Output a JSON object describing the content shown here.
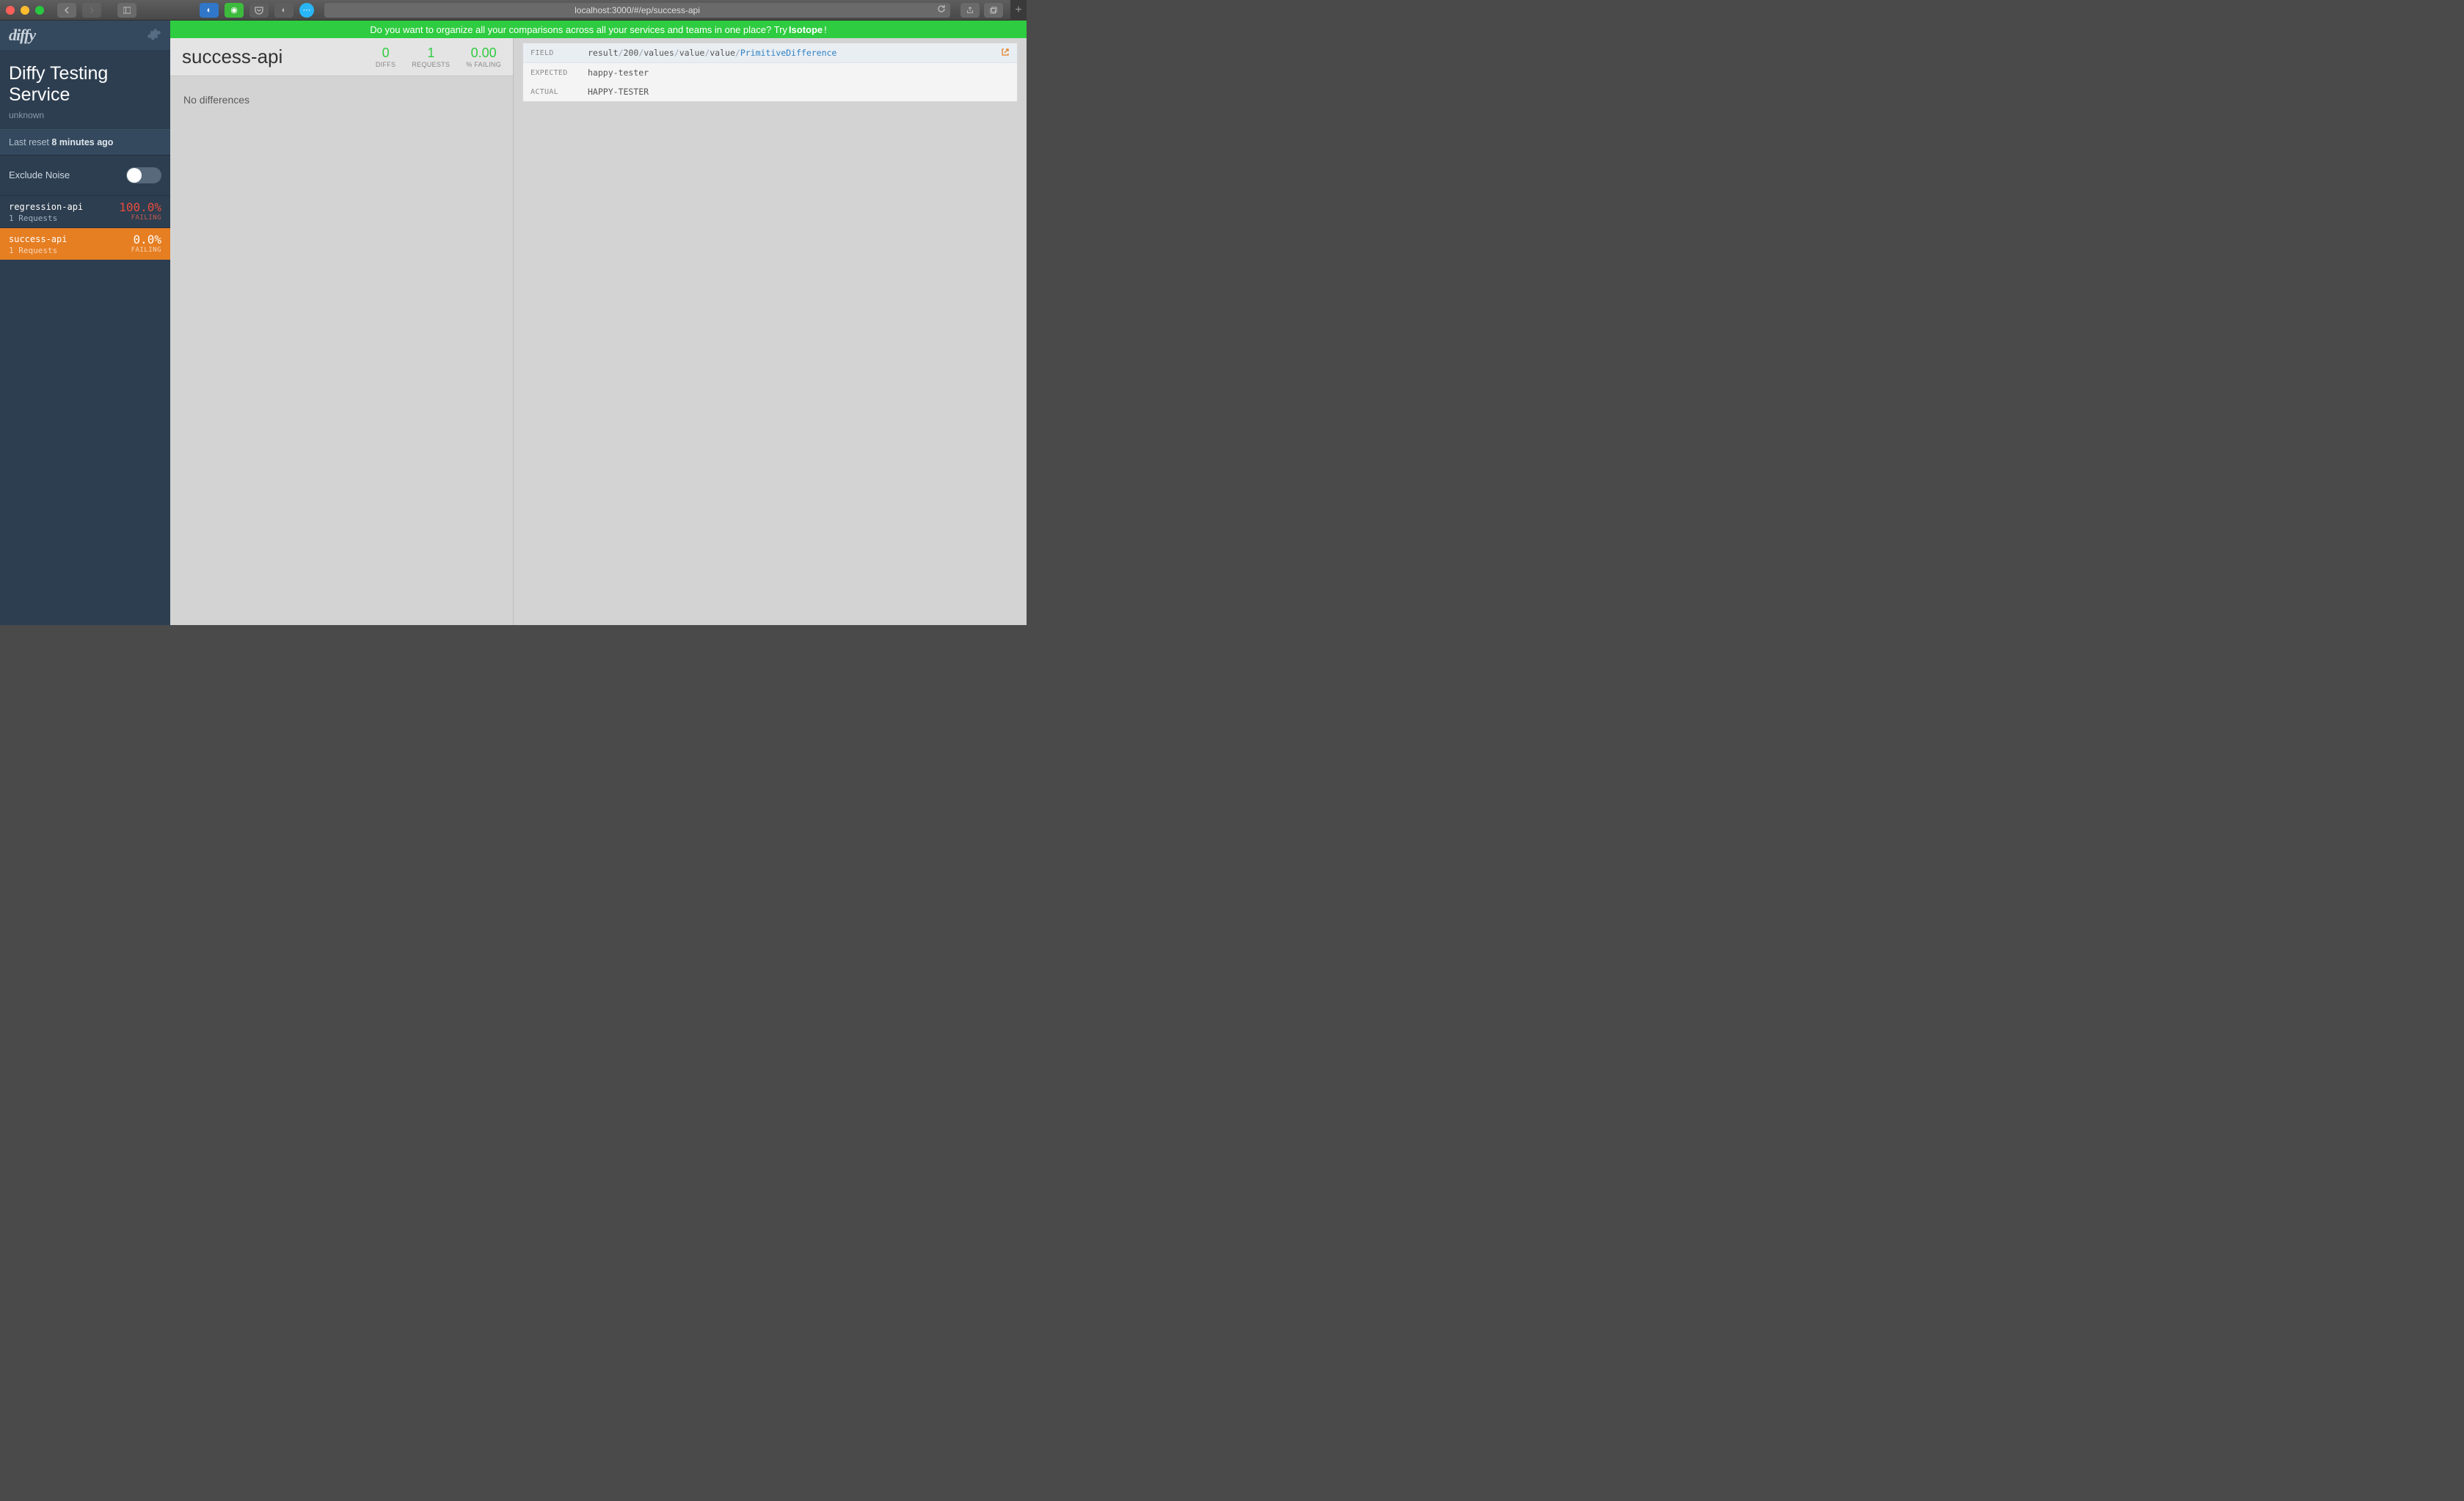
{
  "browser": {
    "url": "localhost:3000/#/ep/success-api"
  },
  "sidebar": {
    "logo": "diffy",
    "service_title": "Diffy Testing Service",
    "service_sub": "unknown",
    "last_reset_prefix": "Last reset ",
    "last_reset_value": "8 minutes ago",
    "exclude_label": "Exclude Noise",
    "endpoints": [
      {
        "name": "regression-api",
        "requests": "1 Requests",
        "pct": "100.0%",
        "failing": "FAILING",
        "active": false,
        "fail": true
      },
      {
        "name": "success-api",
        "requests": "1 Requests",
        "pct": "0.0%",
        "failing": "FAILING",
        "active": true,
        "fail": false
      }
    ]
  },
  "banner": {
    "text_prefix": "Do you want to organize all your comparisons across all your services and teams in one place? Try ",
    "link": "Isotope",
    "text_suffix": "!"
  },
  "header": {
    "title": "success-api",
    "stats": [
      {
        "value": "0",
        "label": "DIFFS"
      },
      {
        "value": "1",
        "label": "REQUESTS"
      },
      {
        "value": "0.00",
        "label": "% FAILING"
      }
    ]
  },
  "center": {
    "no_diff": "No differences"
  },
  "diffcard": {
    "field_label": "FIELD",
    "expected_label": "EXPECTED",
    "actual_label": "ACTUAL",
    "path": [
      "result",
      "200",
      "values",
      "value",
      "value",
      "PrimitiveDifference"
    ],
    "expected": "happy-tester",
    "actual": "HAPPY-TESTER"
  }
}
